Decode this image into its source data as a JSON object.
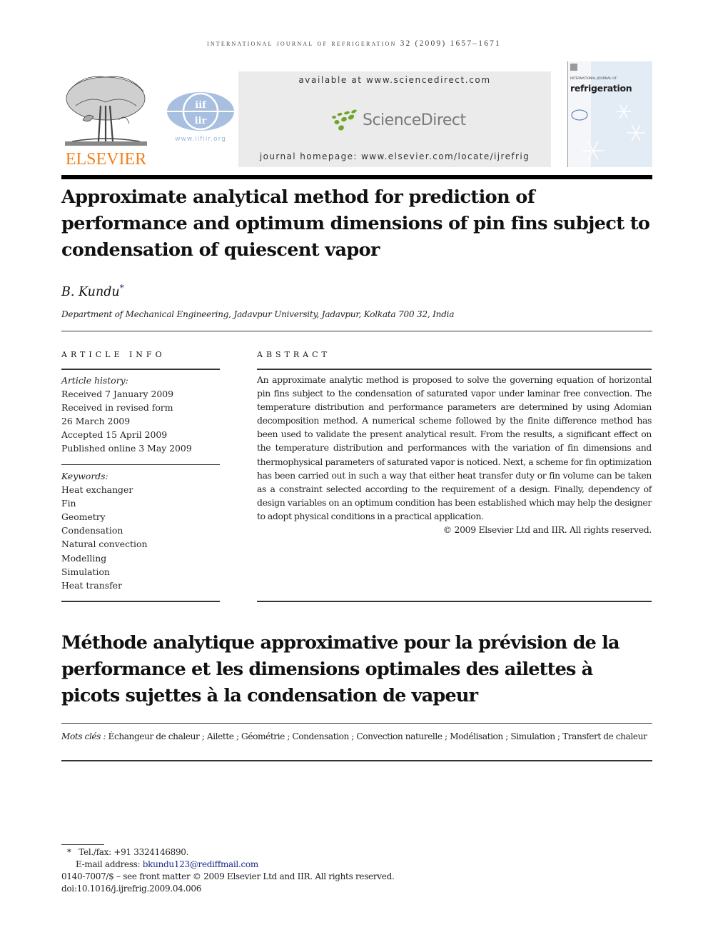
{
  "running_head": "INTERNATIONAL JOURNAL OF REFRIGERATION 32 (2009) 1657–1671",
  "header": {
    "publisher_logo": "ELSEVIER",
    "iif_logo_text": [
      "iif",
      "iir"
    ],
    "iif_url": "www.iifiir.org",
    "available_at": "available at www.sciencedirect.com",
    "sciencedirect_label": "ScienceDirect",
    "journal_homepage": "journal homepage: www.elsevier.com/locate/ijrefrig",
    "cover_journal_name": "refrigeration",
    "cover_journal_prefix": "INTERNATIONAL JOURNAL OF"
  },
  "article": {
    "title": "Approximate analytical method for prediction of performance and optimum dimensions of pin fins subject to condensation of quiescent vapor",
    "author": "B. Kundu",
    "author_mark": "*",
    "affiliation": "Department of Mechanical Engineering, Jadavpur University, Jadavpur, Kolkata 700 32, India"
  },
  "article_info": {
    "heading": "ARTICLE INFO",
    "history_label": "Article history:",
    "history": [
      "Received 7 January 2009",
      "Received in revised form",
      "26 March 2009",
      "Accepted 15 April 2009",
      "Published online 3 May 2009"
    ],
    "keywords_label": "Keywords:",
    "keywords": [
      "Heat exchanger",
      "Fin",
      "Geometry",
      "Condensation",
      "Natural convection",
      "Modelling",
      "Simulation",
      "Heat transfer"
    ]
  },
  "abstract": {
    "heading": "ABSTRACT",
    "text": "An approximate analytic method is proposed to solve the governing equation of horizontal pin fins subject to the condensation of saturated vapor under laminar free convection. The temperature distribution and performance parameters are determined by using Adomian decomposition method. A numerical scheme followed by the finite difference method has been used to validate the present analytical result. From the results, a significant effect on the temperature distribution and performances with the variation of fin dimensions and thermophysical parameters of saturated vapor is noticed. Next, a scheme for fin optimization has been carried out in such a way that either heat transfer duty or fin volume can be taken as a constraint selected according to the requirement of a design. Finally, dependency of design variables on an optimum condition has been established which may help the designer to adopt physical conditions in a practical application.",
    "copyright": "© 2009 Elsevier Ltd and IIR. All rights reserved."
  },
  "french": {
    "title": "Méthode analytique approximative pour la prévision de la performance et les dimensions optimales des ailettes à picots sujettes à la condensation de vapeur",
    "mots_cles_label": "Mots clés :",
    "mots_cles": "Échangeur de chaleur ; Ailette ; Géométrie ; Condensation ; Convection naturelle ; Modélisation ; Simulation ; Transfert de chaleur"
  },
  "footnotes": {
    "mark": "*",
    "tel": "Tel./fax: +91 3324146890.",
    "email_label": "E-mail address:",
    "email": "bkundu123@rediffmail.com",
    "front_matter": "0140-7007/$ – see front matter © 2009 Elsevier Ltd and IIR. All rights reserved.",
    "doi": "doi:10.1016/j.ijrefrig.2009.04.006"
  },
  "colors": {
    "elsevier_orange": "#f07f1a",
    "iif_blue": "#a9bfe0",
    "sciencedirect_green": "#6ea52a",
    "link_blue": "#1c2a8a"
  }
}
